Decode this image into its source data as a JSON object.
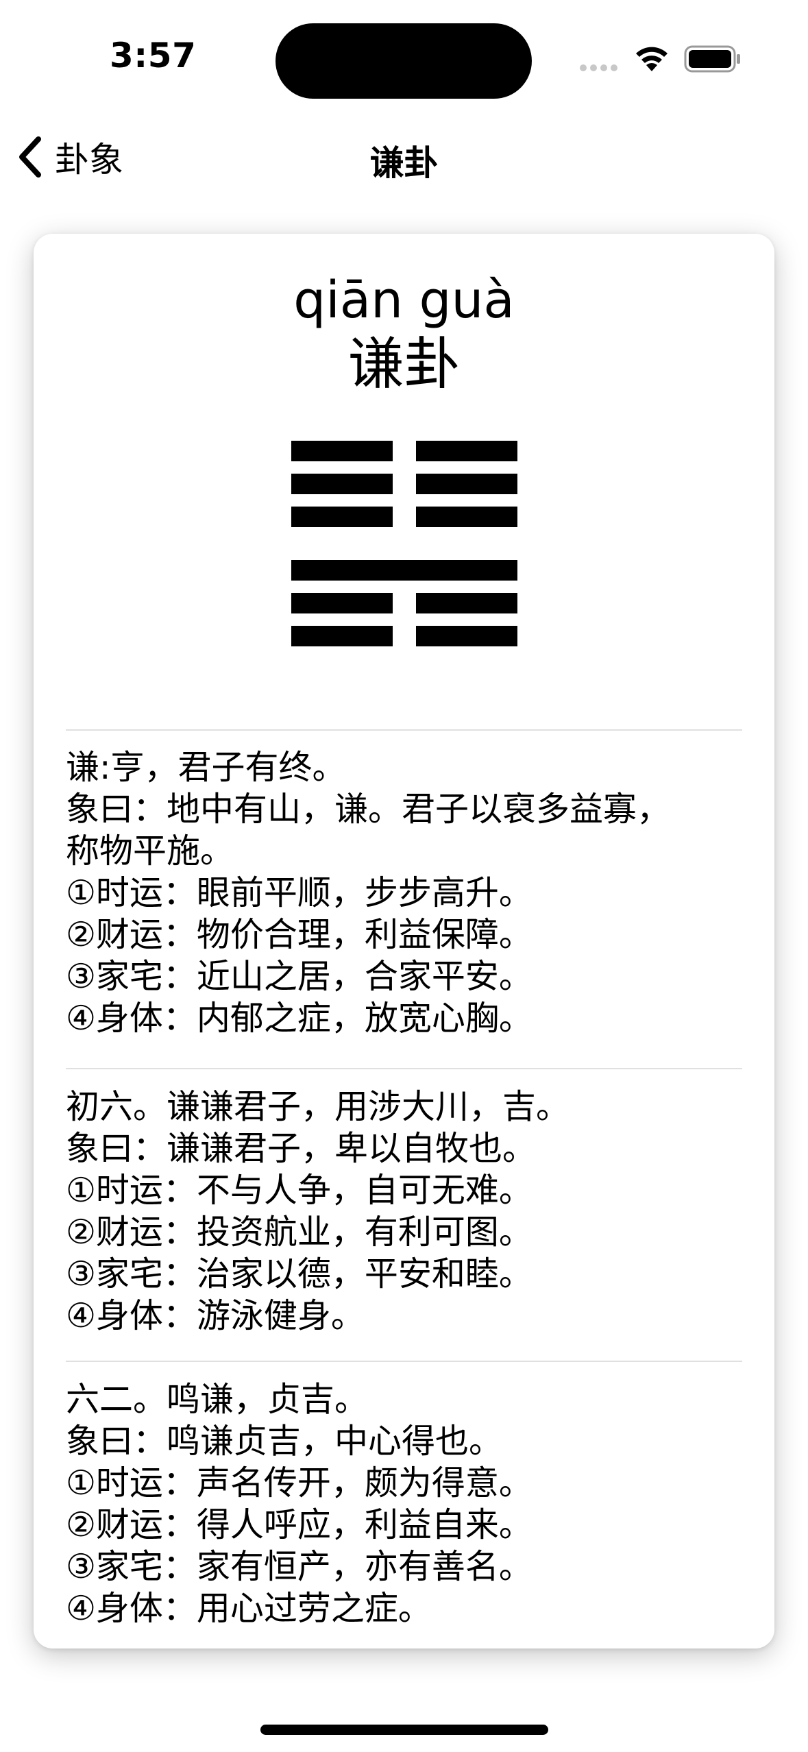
{
  "status_bar": {
    "time": "3:57"
  },
  "nav": {
    "back_label": "卦象",
    "title": "谦卦"
  },
  "card": {
    "pinyin": "qiān guà",
    "hanzi": "谦卦",
    "hexagram": {
      "name": "谦",
      "lines_top_to_bottom": [
        "yin",
        "yin",
        "yin",
        "yang",
        "yin",
        "yin"
      ]
    },
    "sections": [
      {
        "lines": [
          "谦:亨，君子有终。",
          "象曰：地中有山，谦。君子以裒多益寡，",
          "称物平施。",
          "①时运：眼前平顺，步步高升。",
          "②财运：物价合理，利益保障。",
          "③家宅：近山之居，合家平安。",
          "④身体：内郁之症，放宽心胸。"
        ]
      },
      {
        "lines": [
          "初六。谦谦君子，用涉大川，吉。",
          "象曰：谦谦君子，卑以自牧也。",
          "①时运：不与人争，自可无难。",
          "②财运：投资航业，有利可图。",
          "③家宅：治家以德，平安和睦。",
          "④身体：游泳健身。"
        ]
      },
      {
        "lines": [
          "六二。鸣谦，贞吉。",
          "象曰：鸣谦贞吉，中心得也。",
          "①时运：声名传开，颇为得意。",
          "②财运：得人呼应，利益自来。",
          "③家宅：家有恒产，亦有善名。",
          "④身体：用心过劳之症。"
        ]
      }
    ]
  }
}
